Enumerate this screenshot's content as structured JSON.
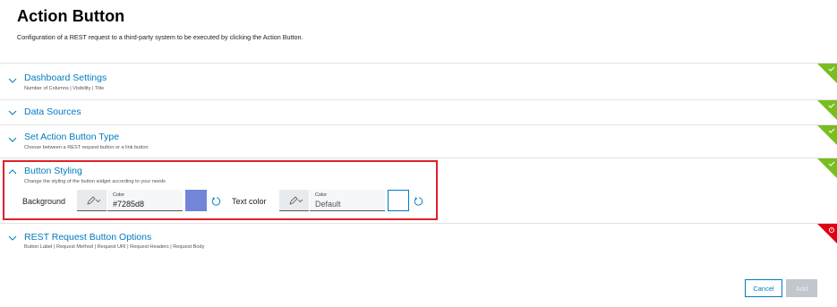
{
  "header": {
    "title": "Action Button",
    "description": "Configuration of a REST request to a third-party system to be executed by clicking the Action Button."
  },
  "sections": [
    {
      "title": "Dashboard Settings",
      "subtitle": "Number of Columns | Visibility | Title",
      "expanded": false,
      "status": "success"
    },
    {
      "title": "Data Sources",
      "subtitle": "",
      "expanded": false,
      "status": "success"
    },
    {
      "title": "Set Action Button Type",
      "subtitle": "Choose between a REST request button or a link button",
      "expanded": false,
      "status": "success"
    },
    {
      "title": "Button Styling",
      "subtitle": "Change the styling of the button widget according to your needs",
      "expanded": true,
      "status": "success"
    },
    {
      "title": "REST Request Button Options",
      "subtitle": "Button Label | Request Method | Request URI | Request Headers | Request Body",
      "expanded": false,
      "status": "error"
    }
  ],
  "styling": {
    "background": {
      "label": "Background",
      "caption": "Color",
      "value": "#7285d8",
      "swatch": "#7285d8"
    },
    "text_color": {
      "label": "Text color",
      "caption": "Color",
      "value": "Default",
      "swatch": "#ffffff"
    }
  },
  "footer": {
    "cancel_label": "Cancel",
    "add_label": "Add"
  },
  "colors": {
    "accent": "#007bc0",
    "success": "#78be20",
    "error": "#e00015",
    "highlight": "#e0202a"
  },
  "icons": [
    "chevron-down-icon",
    "chevron-up-icon",
    "pencil-icon",
    "reset-icon",
    "check-icon",
    "error-icon"
  ]
}
